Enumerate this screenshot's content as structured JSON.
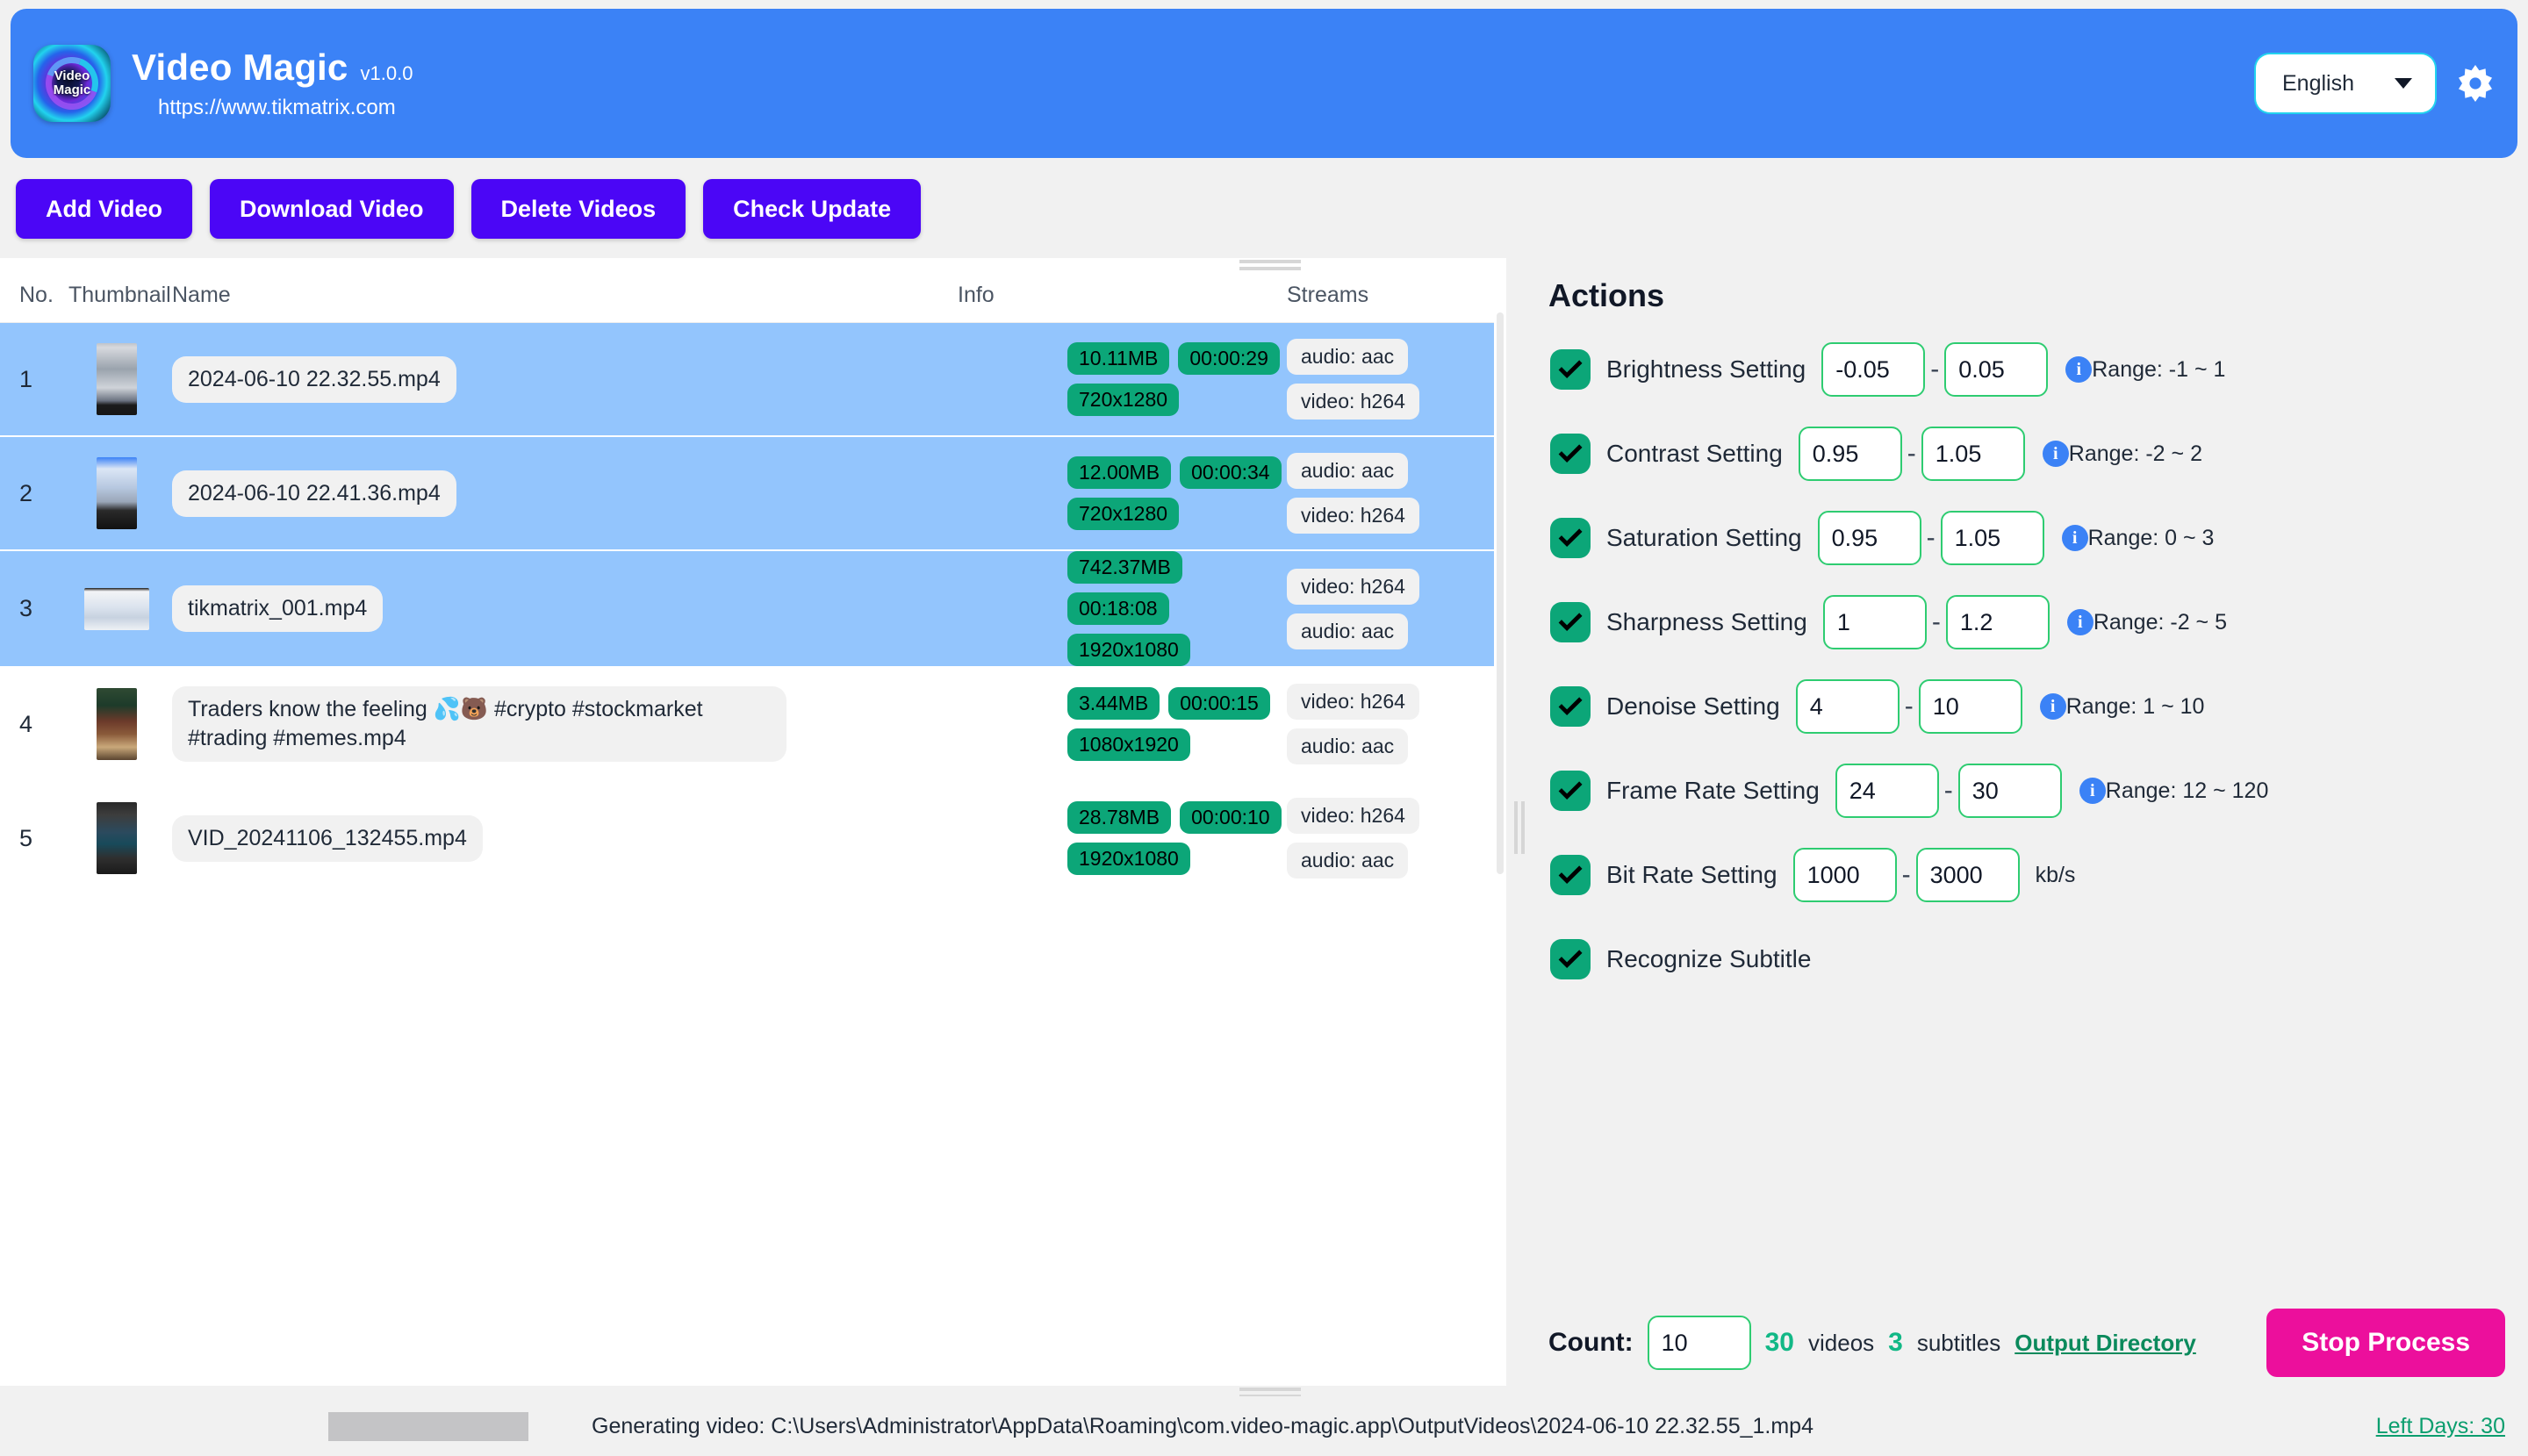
{
  "header": {
    "logo_line1": "Video",
    "logo_line2": "Magic",
    "app_name": "Video Magic",
    "version": "v1.0.0",
    "url": "https://www.tikmatrix.com",
    "language": "English",
    "gear_icon": "gear-icon",
    "accent_color": "#3b82f6"
  },
  "toolbar": {
    "buttons": [
      {
        "label": "Add Video"
      },
      {
        "label": "Download Video"
      },
      {
        "label": "Delete Videos"
      },
      {
        "label": "Check Update"
      }
    ],
    "button_color": "#4b06f6"
  },
  "table": {
    "columns": [
      "No.",
      "Thumbnail",
      "Name",
      "Info",
      "Streams"
    ],
    "rows": [
      {
        "no": "1",
        "name": "2024-06-10 22.32.55.mp4",
        "info": [
          "10.11MB",
          "00:00:29",
          "720x1280"
        ],
        "streams": [
          "audio: aac",
          "video: h264"
        ],
        "selected": true
      },
      {
        "no": "2",
        "name": "2024-06-10 22.41.36.mp4",
        "info": [
          "12.00MB",
          "00:00:34",
          "720x1280"
        ],
        "streams": [
          "audio: aac",
          "video: h264"
        ],
        "selected": true
      },
      {
        "no": "3",
        "name": "tikmatrix_001.mp4",
        "info": [
          "742.37MB",
          "00:18:08",
          "1920x1080"
        ],
        "streams": [
          "video: h264",
          "audio: aac"
        ],
        "selected": true
      },
      {
        "no": "4",
        "name": "Traders know the feeling 💦🐻 #crypto #stockmarket #trading #memes.mp4",
        "info": [
          "3.44MB",
          "00:00:15",
          "1080x1920"
        ],
        "streams": [
          "video: h264",
          "audio: aac"
        ],
        "selected": false
      },
      {
        "no": "5",
        "name": "VID_20241106_132455.mp4",
        "info": [
          "28.78MB",
          "00:00:10",
          "1920x1080"
        ],
        "streams": [
          "video: h264",
          "audio: aac"
        ],
        "selected": false
      }
    ],
    "badge_color": "#0ca678",
    "selected_row_color": "#93c5fd"
  },
  "actions": {
    "title": "Actions",
    "items": [
      {
        "label": "Brightness Setting",
        "checked": true,
        "min": "-0.05",
        "max": "0.05",
        "hint": "Range: -1 ~ 1",
        "unit": ""
      },
      {
        "label": "Contrast Setting",
        "checked": true,
        "min": "0.95",
        "max": "1.05",
        "hint": "Range: -2 ~ 2",
        "unit": ""
      },
      {
        "label": "Saturation Setting",
        "checked": true,
        "min": "0.95",
        "max": "1.05",
        "hint": "Range: 0 ~ 3",
        "unit": ""
      },
      {
        "label": "Sharpness Setting",
        "checked": true,
        "min": "1",
        "max": "1.2",
        "hint": "Range: -2 ~ 5",
        "unit": ""
      },
      {
        "label": "Denoise Setting",
        "checked": true,
        "min": "4",
        "max": "10",
        "hint": "Range: 1 ~ 10",
        "unit": ""
      },
      {
        "label": "Frame Rate Setting",
        "checked": true,
        "min": "24",
        "max": "30",
        "hint": "Range: 12 ~ 120",
        "unit": ""
      },
      {
        "label": "Bit Rate Setting",
        "checked": true,
        "min": "1000",
        "max": "3000",
        "hint": "",
        "unit": "kb/s"
      },
      {
        "label": "Recognize Subtitle",
        "checked": true,
        "min": null,
        "max": null,
        "hint": "",
        "unit": ""
      }
    ],
    "separator": "-",
    "info_icon": "info-icon",
    "checkbox_color": "#0ca678",
    "input_border_color": "#2ecc71"
  },
  "footer": {
    "count_label": "Count:",
    "count_value": "10",
    "videos_count": "30",
    "videos_word": "videos",
    "subtitles_count": "3",
    "subtitles_word": "subtitles",
    "output_directory_link": "Output Directory",
    "stop_button": "Stop Process",
    "stop_button_color": "#ec0f9c"
  },
  "statusbar": {
    "status_text": "Generating video: C:\\Users\\Administrator\\AppData\\Roaming\\com.video-magic.app\\OutputVideos\\2024-06-10 22.32.55_1.mp4",
    "left_days": "Left Days: 30",
    "progress_color": "#4b06f6"
  }
}
